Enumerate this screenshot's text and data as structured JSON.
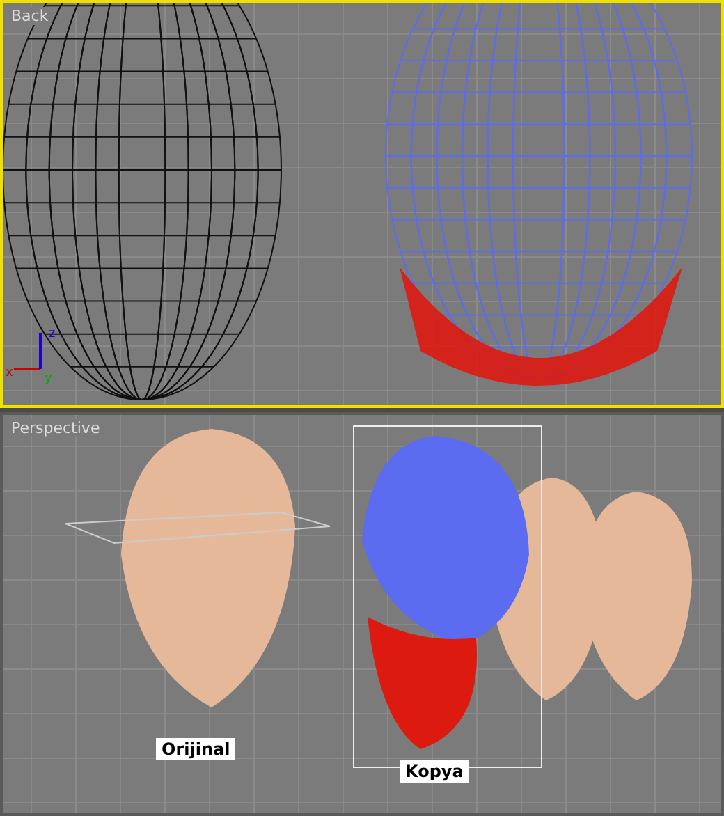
{
  "viewports": [
    {
      "kind": "back",
      "label": "Back",
      "active": true,
      "axes": {
        "x": "x",
        "y": "y",
        "z": "z"
      }
    },
    {
      "kind": "perspective",
      "label": "Perspective",
      "active": false,
      "captions": [
        "Orijinal",
        "Kopya"
      ]
    }
  ]
}
